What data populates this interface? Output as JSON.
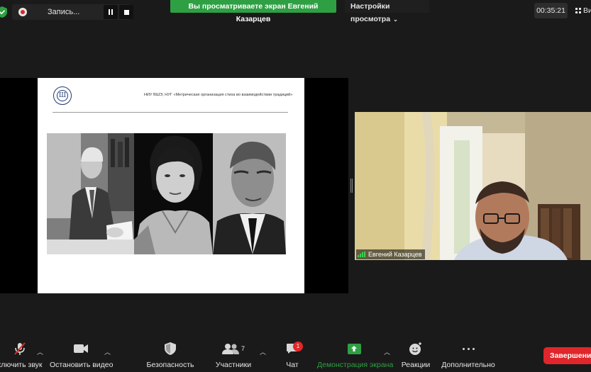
{
  "top_bar": {
    "recording_label": "Запись...",
    "share_banner": "Вы просматриваете экран Евгений Казарцев",
    "view_options": "Настройки просмотра",
    "timer": "00:35:21",
    "view_label": "Ви"
  },
  "slide": {
    "header": "НИУ ВШЭ, НУГ «Метрическая организация стиха во взаимодействии традиций»",
    "logo_text": "Ш"
  },
  "speaker": {
    "name": "Евгений Казарцев"
  },
  "toolbar": {
    "audio": "ключить звук",
    "video": "Остановить видео",
    "security": "Безопасность",
    "participants": "Участники",
    "participants_count": "7",
    "chat": "Чат",
    "chat_badge": "1",
    "share": "Демонстрация экрана",
    "reactions": "Реакции",
    "more": "Дополнительно",
    "end": "Завершение"
  },
  "colors": {
    "share_green": "#2ea043",
    "end_red": "#e0262b",
    "badge_red": "#e02828"
  }
}
